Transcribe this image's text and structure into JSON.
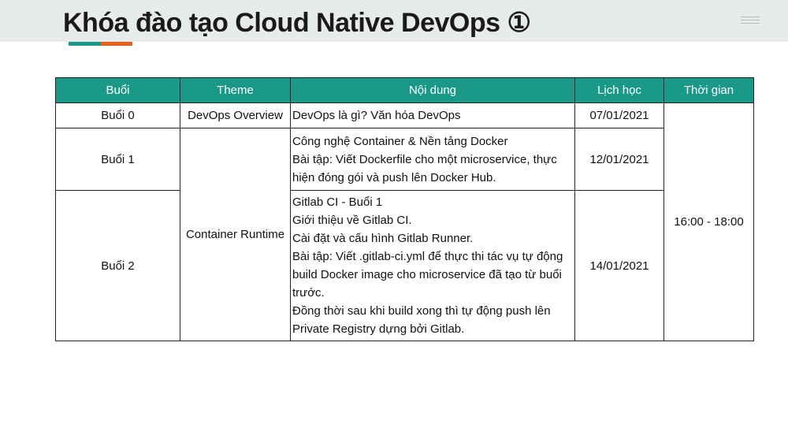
{
  "title": "Khóa đào tạo Cloud Native DevOps ①",
  "colors": {
    "accent_teal": "#1a9988",
    "accent_orange": "#e8611a",
    "table_header": "#1a9988",
    "header_band": "#e8ebec"
  },
  "icons": {
    "menu": "menu-lines-icon"
  },
  "table": {
    "headers": [
      "Buổi",
      "Theme",
      "Nội dung",
      "Lịch học",
      "Thời gian"
    ],
    "time": "16:00 - 18:00",
    "theme_container": "Container Runtime",
    "rows": [
      {
        "session": "Buổi 0",
        "theme": "DevOps Overview",
        "content": [
          "DevOps là gì? Văn hóa DevOps"
        ],
        "date": "07/01/2021"
      },
      {
        "session": "Buổi 1",
        "content": [
          "Công nghệ Container & Nền tảng Docker",
          "Bài tập: Viết Dockerfile cho một microservice, thực hiện đóng gói và push lên Docker Hub."
        ],
        "date": "12/01/2021"
      },
      {
        "session": "Buổi 2",
        "content": [
          "Gitlab CI - Buổi 1",
          "Giới thiệu về Gitlab CI.",
          "Cài đặt và cấu hình Gitlab Runner.",
          "Bài tập: Viết .gitlab-ci.yml để thực thi tác vụ tự động build Docker image cho microservice đã tạo từ buổi trước.",
          "Đồng thời sau khi build xong thì tự động push lên Private Registry dựng bởi Gitlab."
        ],
        "date": "14/01/2021"
      }
    ]
  }
}
